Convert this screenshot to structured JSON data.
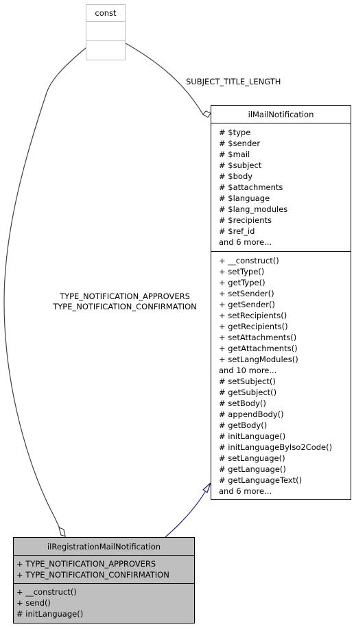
{
  "diagram": {
    "type": "uml-class-collaboration",
    "nodes": {
      "const": {
        "name": "const",
        "attributes": [],
        "operations": []
      },
      "mail": {
        "name": "ilMailNotification",
        "attributes": [
          "# $type",
          "# $sender",
          "# $mail",
          "# $subject",
          "# $body",
          "# $attachments",
          "# $language",
          "# $lang_modules",
          "# $recipients",
          "# $ref_id",
          "and 6 more..."
        ],
        "operations": [
          "+ __construct()",
          "+ setType()",
          "+ getType()",
          "+ setSender()",
          "+ getSender()",
          "+ setRecipients()",
          "+ getRecipients()",
          "+ setAttachments()",
          "+ getAttachments()",
          "+ setLangModules()",
          "and 10 more...",
          "# setSubject()",
          "# getSubject()",
          "# setBody()",
          "# appendBody()",
          "# getBody()",
          "# initLanguage()",
          "# initLanguageByIso2Code()",
          "# setLanguage()",
          "# getLanguage()",
          "# getLanguageText()",
          "and 6 more..."
        ]
      },
      "reg": {
        "name": "ilRegistrationMailNotification",
        "attributes": [
          "+ TYPE_NOTIFICATION_APPROVERS",
          "+ TYPE_NOTIFICATION_CONFIRMATION"
        ],
        "operations": [
          "+ __construct()",
          "+ send()",
          "# initLanguage()"
        ]
      }
    },
    "edges": [
      {
        "from": "const",
        "to": "ilMailNotification",
        "kind": "usage-aggregation",
        "label": "SUBJECT_TITLE_LENGTH",
        "color": "#404040"
      },
      {
        "from": "const",
        "to": "ilRegistrationMailNotification",
        "kind": "usage-aggregation",
        "label_lines": [
          "TYPE_NOTIFICATION_APPROVERS",
          "TYPE_NOTIFICATION_CONFIRMATION"
        ],
        "color": "#404040"
      },
      {
        "from": "ilRegistrationMailNotification",
        "to": "ilMailNotification",
        "kind": "inheritance",
        "color": "#191970"
      }
    ],
    "colors": {
      "highlight_node_fill": "#bfbfbf",
      "const_border": "#bfbfbf",
      "node_border": "#000000",
      "inheritance_edge": "#191970",
      "usage_edge": "#404040"
    }
  }
}
